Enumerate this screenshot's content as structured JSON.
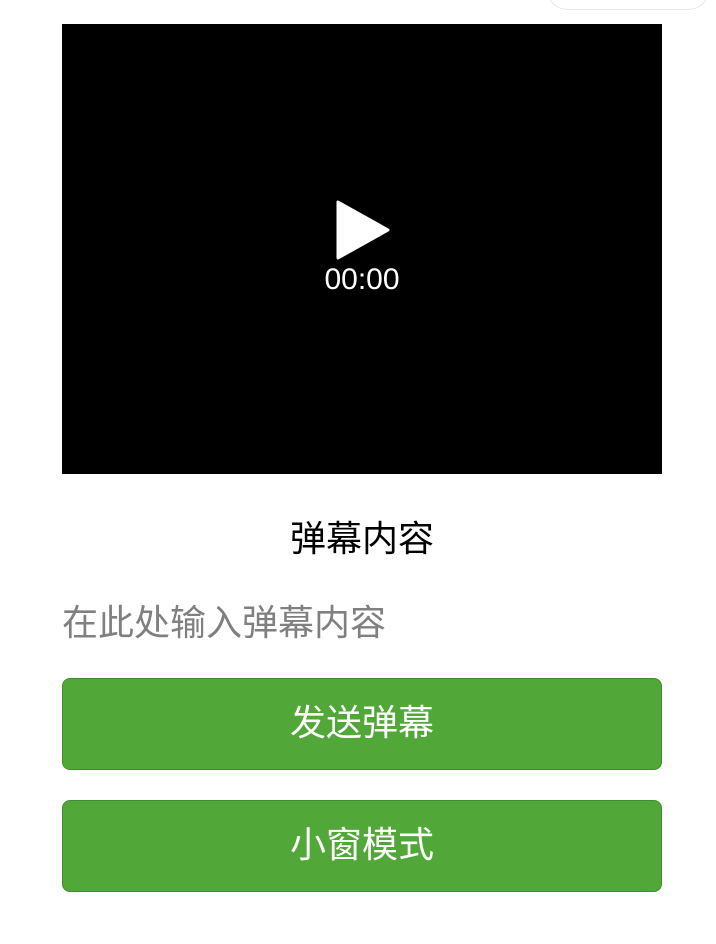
{
  "video": {
    "time": "00:00",
    "play_icon": "play-icon"
  },
  "danmu": {
    "title": "弹幕内容",
    "input_value": "",
    "input_placeholder": "在此处输入弹幕内容"
  },
  "buttons": {
    "send_label": "发送弹幕",
    "pip_label": "小窗模式"
  },
  "colors": {
    "button_bg": "#51a838",
    "video_bg": "#000000",
    "placeholder": "#808080"
  }
}
